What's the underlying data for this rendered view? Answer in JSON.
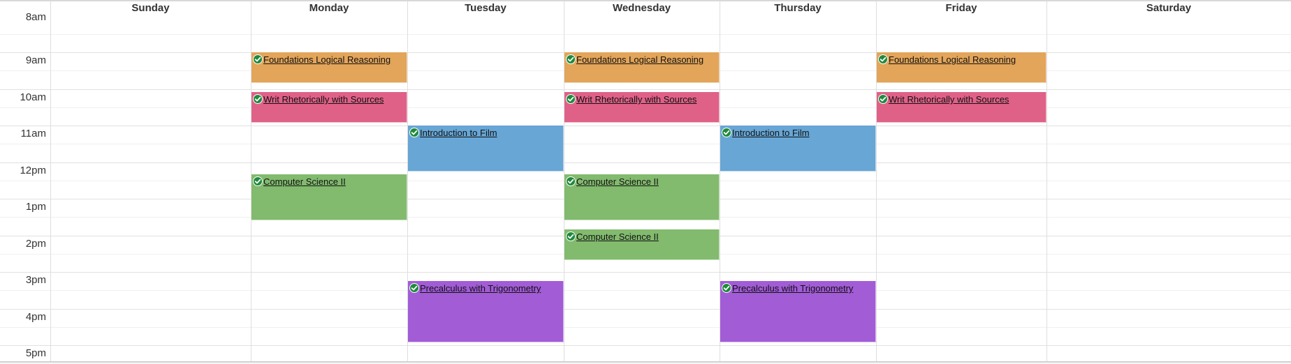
{
  "days": [
    "Sunday",
    "Monday",
    "Tuesday",
    "Wednesday",
    "Thursday",
    "Friday",
    "Saturday"
  ],
  "times": [
    "8am",
    "9am",
    "10am",
    "11am",
    "12pm",
    "1pm",
    "2pm",
    "3pm",
    "4pm",
    "5pm"
  ],
  "colors": {
    "orange": "#E3A55A",
    "pink": "#E06188",
    "blue": "#67A6D5",
    "green": "#82BA6E",
    "purple": "#A25CD6",
    "check": "#1F8A3C"
  },
  "events": [
    {
      "title": "Foundations Logical Reasoning",
      "day": "Monday",
      "start": "9:00am",
      "end": "9:50am",
      "color": "orange"
    },
    {
      "title": "Foundations Logical Reasoning",
      "day": "Wednesday",
      "start": "9:00am",
      "end": "9:50am",
      "color": "orange"
    },
    {
      "title": "Foundations Logical Reasoning",
      "day": "Friday",
      "start": "9:00am",
      "end": "9:50am",
      "color": "orange"
    },
    {
      "title": "Writ Rhetorically with Sources",
      "day": "Monday",
      "start": "10:05am",
      "end": "10:55am",
      "color": "pink"
    },
    {
      "title": "Writ Rhetorically with Sources",
      "day": "Wednesday",
      "start": "10:05am",
      "end": "10:55am",
      "color": "pink"
    },
    {
      "title": "Writ Rhetorically with Sources",
      "day": "Friday",
      "start": "10:05am",
      "end": "10:55am",
      "color": "pink"
    },
    {
      "title": "Introduction to Film",
      "day": "Tuesday",
      "start": "11:00am",
      "end": "12:15pm",
      "color": "blue"
    },
    {
      "title": "Introduction to Film",
      "day": "Thursday",
      "start": "11:00am",
      "end": "12:15pm",
      "color": "blue"
    },
    {
      "title": "Computer Science II",
      "day": "Monday",
      "start": "12:20pm",
      "end": "1:35pm",
      "color": "green"
    },
    {
      "title": "Computer Science II",
      "day": "Wednesday",
      "start": "12:20pm",
      "end": "1:35pm",
      "color": "green"
    },
    {
      "title": "Computer Science II",
      "day": "Wednesday",
      "start": "1:50pm",
      "end": "2:40pm",
      "color": "green"
    },
    {
      "title": "Precalculus with Trigonometry",
      "day": "Tuesday",
      "start": "3:15pm",
      "end": "4:55pm",
      "color": "purple"
    },
    {
      "title": "Precalculus with Trigonometry",
      "day": "Thursday",
      "start": "3:15pm",
      "end": "4:55pm",
      "color": "purple"
    }
  ]
}
